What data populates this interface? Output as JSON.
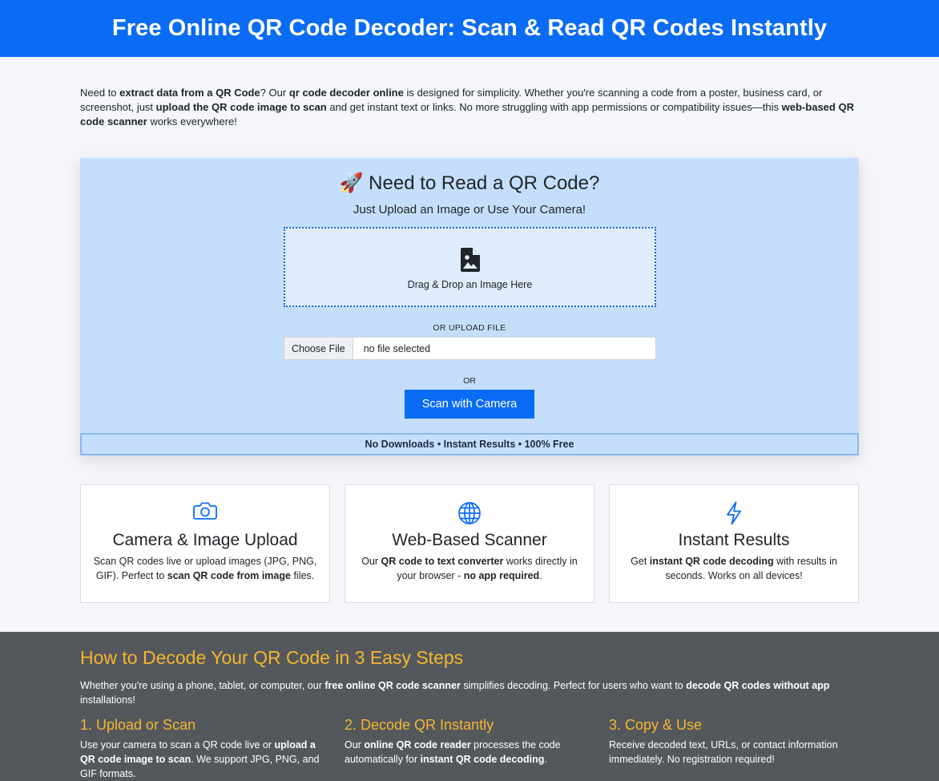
{
  "header": {
    "title": "Free Online QR Code Decoder: Scan & Read QR Codes Instantly"
  },
  "intro": {
    "t1": "Need to ",
    "b1": "extract data from a QR Code",
    "t2": "? Our ",
    "b2": "qr code decoder online",
    "t3": " is designed for simplicity. Whether you're scanning a code from a poster, business card, or screenshot, just ",
    "b3": "upload the QR code image to scan",
    "t4": " and get instant text or links. No more struggling with app permissions or compatibility issues—this ",
    "b4": "web-based QR code scanner",
    "t5": " works everywhere!"
  },
  "scanner": {
    "title": "🚀 Need to Read a QR Code?",
    "subtitle": "Just Upload an Image or Use Your Camera!",
    "dropzone_label": "Drag & Drop an Image Here",
    "or_upload_label": "OR UPLOAD FILE",
    "choose_file_label": "Choose File",
    "file_status": "no file selected",
    "or_label": "OR",
    "camera_button": "Scan with Camera",
    "banner": "No Downloads • Instant Results • 100% Free"
  },
  "features": [
    {
      "icon": "camera-icon",
      "title": "Camera & Image Upload",
      "t1": "Scan QR codes live or upload images (JPG, PNG, GIF). Perfect to ",
      "b1": "scan QR code from image",
      "t2": " files.",
      "b2": "",
      "t3": ""
    },
    {
      "icon": "globe-icon",
      "title": "Web-Based Scanner",
      "t1": "Our ",
      "b1": "QR code to text converter",
      "t2": " works directly in your browser - ",
      "b2": "no app required",
      "t3": "."
    },
    {
      "icon": "lightning-icon",
      "title": "Instant Results",
      "t1": "Get ",
      "b1": "instant QR code decoding",
      "t2": " with results in seconds. Works on all devices!",
      "b2": "",
      "t3": ""
    }
  ],
  "how_to": {
    "title": "How to Decode Your QR Code in 3 Easy Steps",
    "t1": "Whether you're using a phone, tablet, or computer, our ",
    "b1": "free online QR code scanner",
    "t2": " simplifies decoding. Perfect for users who want to ",
    "b2": "decode QR codes without app",
    "t3": " installations!",
    "steps": [
      {
        "title": "1. Upload or Scan",
        "t1": "Use your camera to scan a QR code live or ",
        "b1": "upload a QR code image to scan",
        "t2": ". We support JPG, PNG, and GIF formats.",
        "b2": "",
        "t3": ""
      },
      {
        "title": "2. Decode QR Instantly",
        "t1": "Our ",
        "b1": "online QR code reader",
        "t2": " processes the code automatically for ",
        "b2": "instant QR code decoding",
        "t3": "."
      },
      {
        "title": "3. Copy & Use",
        "t1": "Receive decoded text, URLs, or contact information immediately. No registration required!",
        "b1": "",
        "t2": "",
        "b2": "",
        "t3": ""
      }
    ]
  },
  "colors": {
    "primary": "#0a6cf5",
    "accent": "#f5b62c",
    "panel": "#c5defb",
    "dark": "#54585c"
  }
}
